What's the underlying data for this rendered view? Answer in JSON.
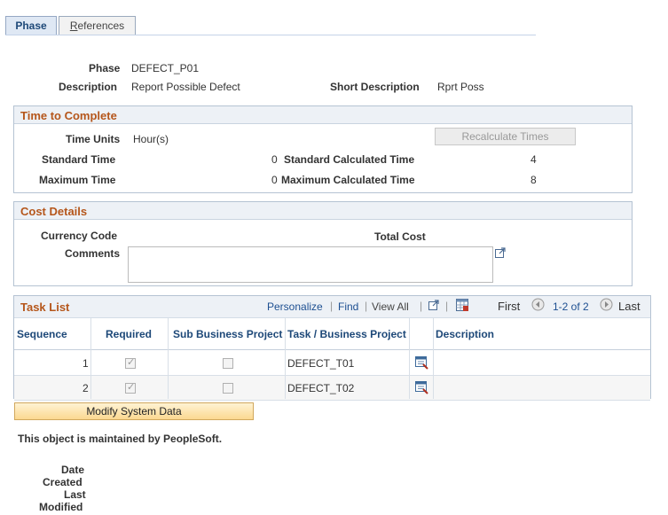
{
  "tabs": {
    "phase": "Phase",
    "references_label": "eferences",
    "references_accel": "R"
  },
  "header": {
    "phase_label": "Phase",
    "phase_value": "DEFECT_P01",
    "description_label": "Description",
    "description_value": "Report Possible Defect",
    "short_description_label": "Short Description",
    "short_description_value": "Rprt Poss"
  },
  "time_to_complete": {
    "title": "Time to Complete",
    "time_units_label": "Time Units",
    "time_units_value": "Hour(s)",
    "recalculate_button": "Recalculate Times",
    "standard_time_label": "Standard Time",
    "standard_time_value": "0",
    "standard_calc_label": "Standard Calculated Time",
    "standard_calc_value": "4",
    "maximum_time_label": "Maximum Time",
    "maximum_time_value": "0",
    "maximum_calc_label": "Maximum Calculated Time",
    "maximum_calc_value": "8"
  },
  "cost_details": {
    "title": "Cost Details",
    "currency_code_label": "Currency Code",
    "total_cost_label": "Total Cost",
    "comments_label": "Comments",
    "comments_value": ""
  },
  "task_list": {
    "title": "Task List",
    "personalize": "Personalize",
    "find": "Find",
    "view_all": "View All",
    "first": "First",
    "range": "1-2 of 2",
    "last": "Last",
    "columns": [
      "Sequence",
      "Required",
      "Sub Business Project",
      "Task / Business Project",
      "",
      "Description"
    ],
    "rows": [
      {
        "sequence": "1",
        "required": true,
        "sub_project": false,
        "task": "DEFECT_T01",
        "description": ""
      },
      {
        "sequence": "2",
        "required": true,
        "sub_project": false,
        "task": "DEFECT_T02",
        "description": ""
      }
    ]
  },
  "footer": {
    "modify_button": "Modify System Data",
    "maintained_note": "This object is maintained by PeopleSoft.",
    "date_created_label_1": "Date",
    "date_created_label_2": "Created",
    "last_modified_label_1": "Last",
    "last_modified_label_2": "Modified"
  },
  "colors": {
    "accent_title": "#b5561b",
    "link": "#1d4f91",
    "header_bg": "#edf1f6"
  }
}
